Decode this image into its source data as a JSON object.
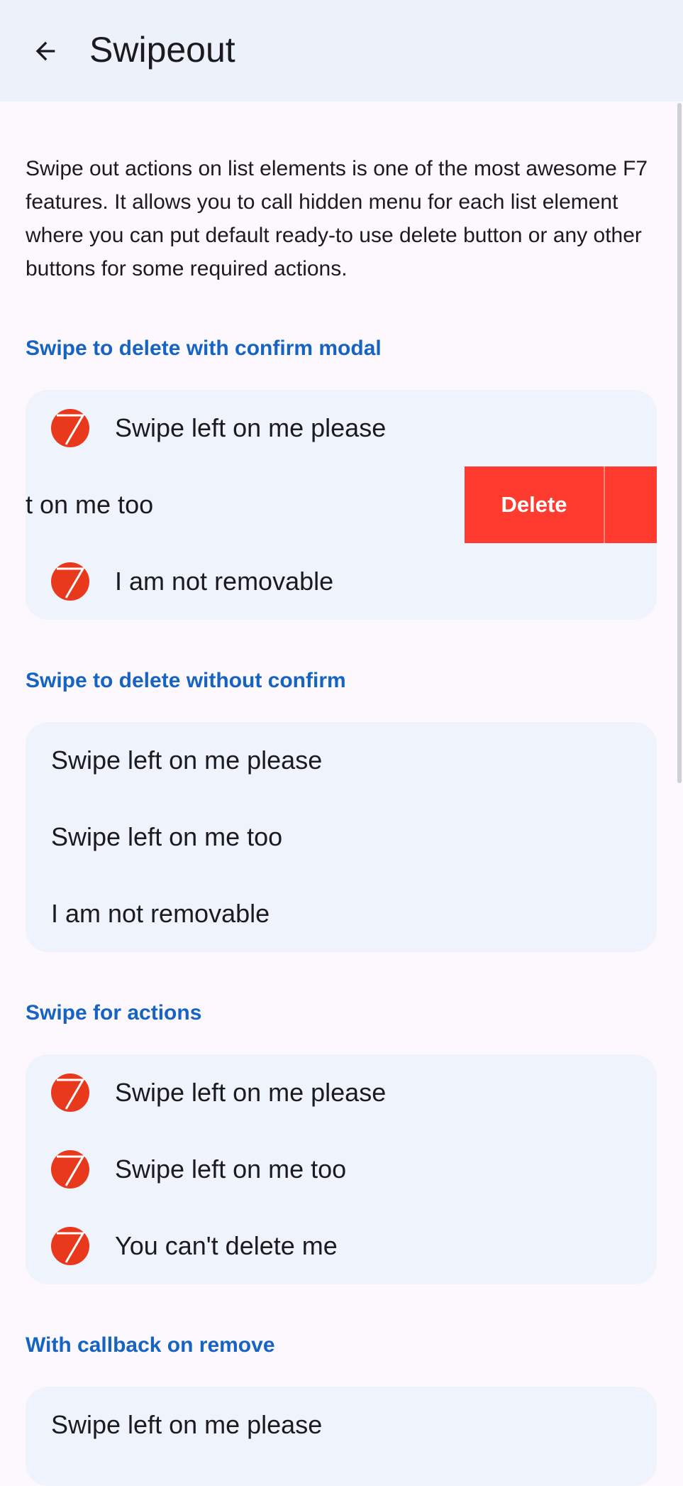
{
  "nav": {
    "title": "Swipeout",
    "back_icon": "arrow-left-icon"
  },
  "intro": "Swipe out actions on list elements is one of the most awesome F7 features. It allows you to call hidden menu for each list element where you can put default ready-to use delete button or any other buttons for some required actions.",
  "colors": {
    "accent": "#1563c2",
    "danger": "#ff3b30",
    "media": "#e8391d",
    "list_bg": "#eff3fb",
    "navbar_bg": "#edf1fa"
  },
  "sections": [
    {
      "title": "Swipe to delete with confirm modal",
      "items": [
        {
          "label": "Swipe left on me please"
        },
        {
          "label": "t on me too",
          "action": "Delete"
        },
        {
          "label": "I am not removable"
        }
      ]
    },
    {
      "title": "Swipe to delete without confirm",
      "items": [
        {
          "label": "Swipe left on me please"
        },
        {
          "label": "Swipe left on me too"
        },
        {
          "label": "I am not removable"
        }
      ]
    },
    {
      "title": "Swipe for actions",
      "items": [
        {
          "label": "Swipe left on me please"
        },
        {
          "label": "Swipe left on me too"
        },
        {
          "label": "You can't delete me"
        }
      ]
    },
    {
      "title": "With callback on remove",
      "items": [
        {
          "label": "Swipe left on me please"
        }
      ]
    }
  ]
}
